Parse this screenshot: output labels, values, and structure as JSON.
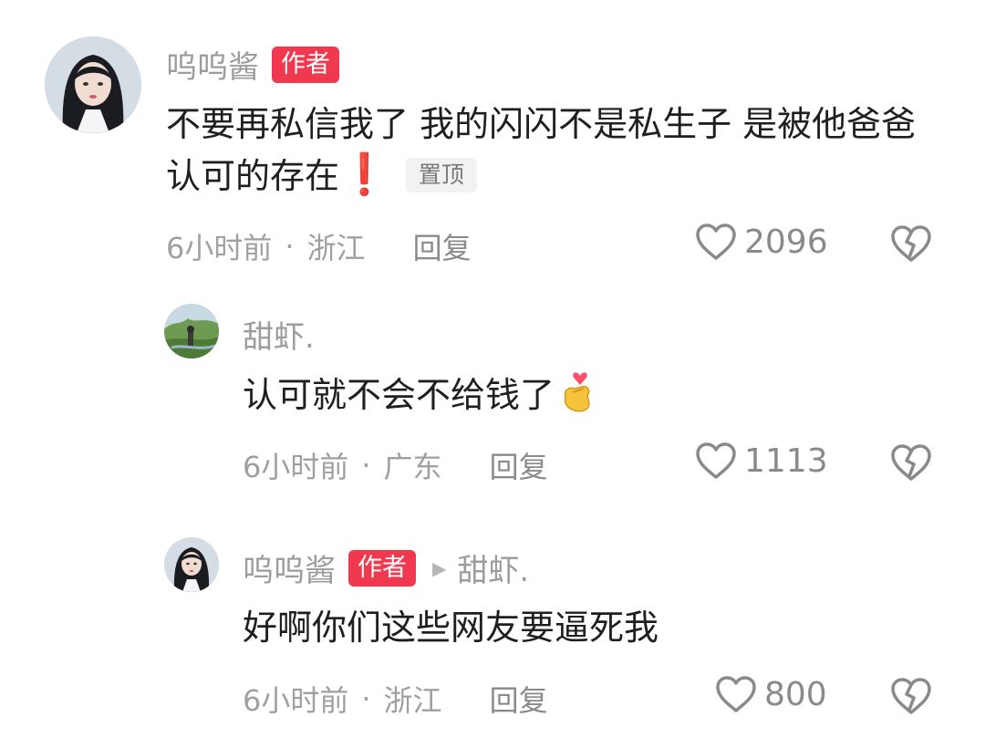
{
  "comments": [
    {
      "username": "呜呜酱",
      "badge": "作者",
      "text": "不要再私信我了 我的闪闪不是私生子 是被他爸爸认可的存在",
      "emoji": "❗",
      "pinned_label": "置顶",
      "time": "6小时前",
      "location": "浙江",
      "reply_label": "回复",
      "likes": "2096"
    },
    {
      "username": "甜虾.",
      "text": "认可就不会不给钱了",
      "emoji": "🫰",
      "time": "6小时前",
      "location": "广东",
      "reply_label": "回复",
      "likes": "1113"
    },
    {
      "username": "呜呜酱",
      "badge": "作者",
      "reply_to": "甜虾.",
      "text": "好啊你们这些网友要逼死我",
      "time": "6小时前",
      "location": "浙江",
      "reply_label": "回复",
      "likes": "800"
    }
  ],
  "separator": "·",
  "colors": {
    "badge": "#f0384f",
    "muted": "#9c9c9c",
    "text": "#1f1f1f"
  },
  "icons": {
    "like": "heart-icon",
    "dislike": "broken-heart-icon",
    "reply_arrow": "triangle-right-icon"
  }
}
